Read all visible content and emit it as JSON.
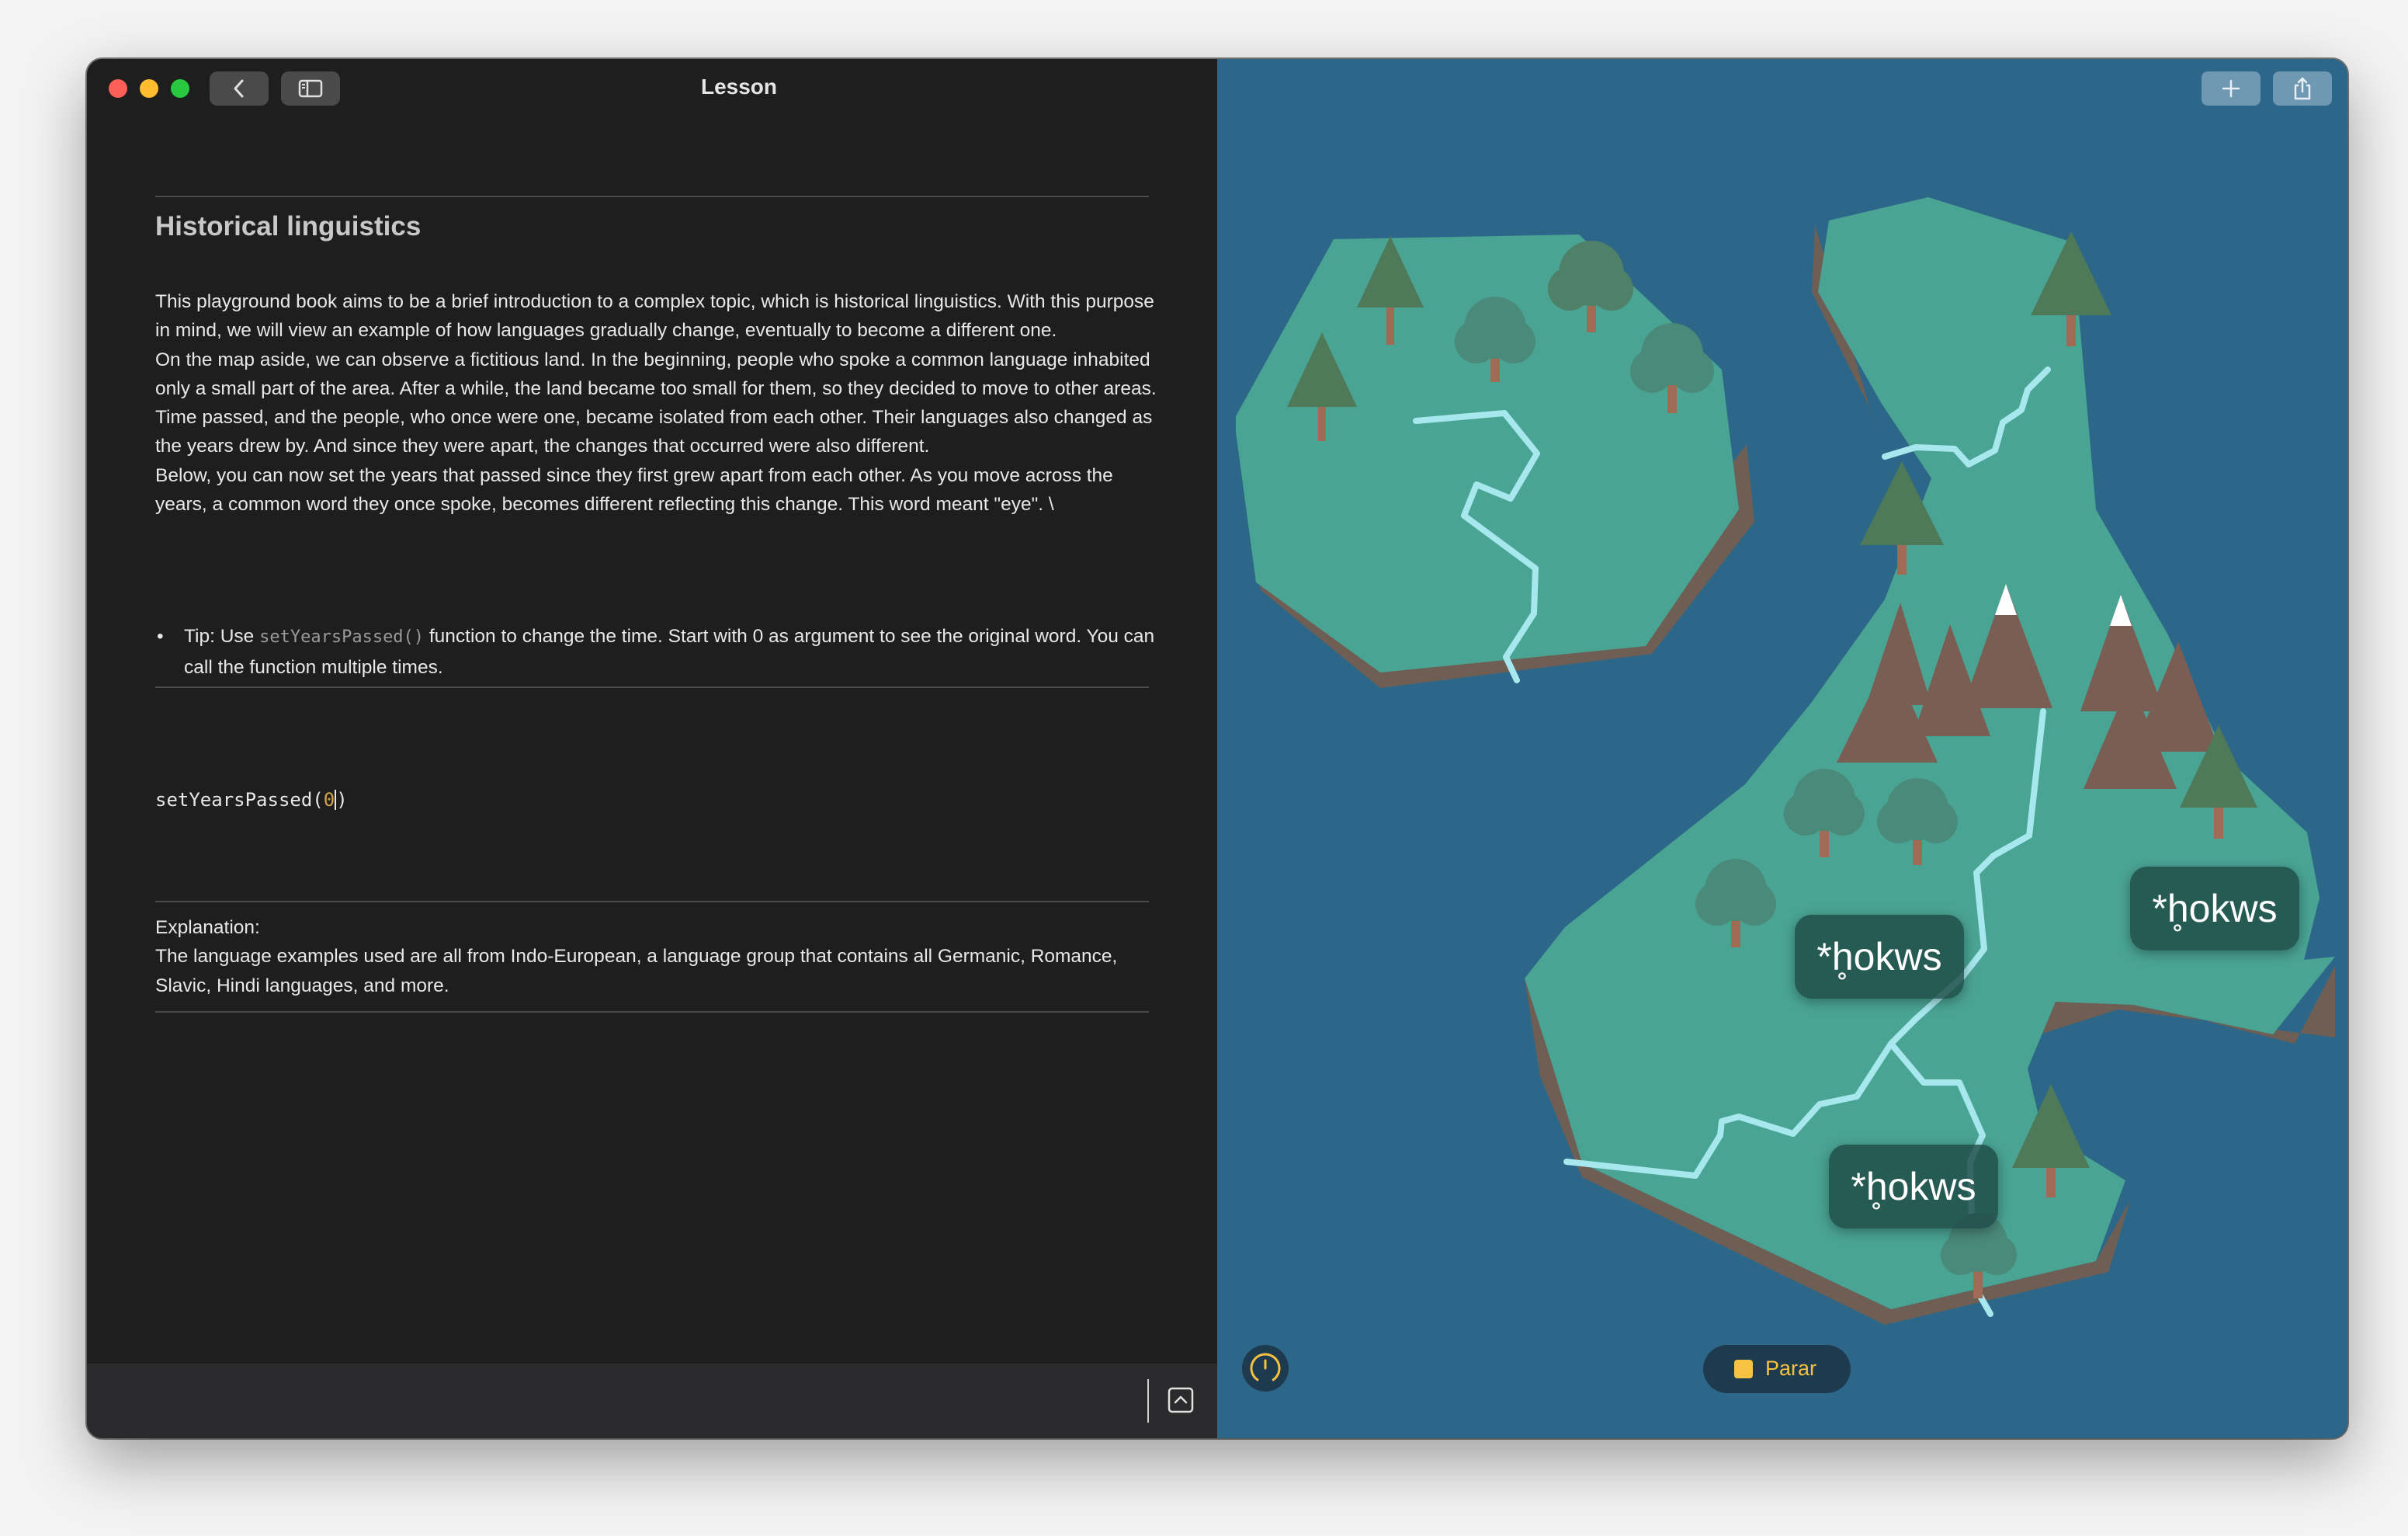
{
  "window": {
    "title": "Lesson"
  },
  "lesson": {
    "heading": "Historical linguistics",
    "paragraphs": [
      "This playground book aims to be a brief introduction to a complex topic, which is historical linguistics. With this purpose in mind, we will view an example of how languages gradually change, eventually to become a different one.",
      "On the map aside, we can observe a fictitious land. In the beginning, people who spoke a common language inhabited only a small part of the area. After a while, the land became too small for them, so they decided to move to other areas. Time passed, and the people, who once were one,  became isolated from each other. Their languages also changed as the years drew by. And since they were apart, the changes that occurred were also different.",
      "Below, you can now set the years that passed since they first grew apart from each other. As you move across the years, a common word they once spoke, becomes different reflecting this change. This word meant \"eye\". \\"
    ],
    "tip": {
      "bullet": "•",
      "prefix": "Tip: Use ",
      "code": "setYearsPassed()",
      "suffix": " function to change the time. Start with 0 as argument to see the original word. You can call the function multiple times."
    },
    "code": {
      "func_open": "setYearsPassed(",
      "arg": "0",
      "close": ")"
    },
    "explanation": {
      "label": "Explanation:",
      "text": "The language examples used are all from Indo-European, a language group that contains all Germanic, Romance, Slavic, Hindi languages, and more."
    }
  },
  "map": {
    "labels": [
      "*h̥okws",
      "*h̥okws",
      "*h̥okws"
    ],
    "colors": {
      "sea": "#2c6789",
      "land": "#4aa494",
      "cliff": "#6e5e54",
      "river": "#a6e8ee",
      "tree_top": "#4f7a5a",
      "bush": "#4a8a7a",
      "mountain": "#7a5e54"
    }
  },
  "controls": {
    "stop_label": "Parar",
    "icons": {
      "back": "chevron-left-icon",
      "sidebar": "sidebar-icon",
      "add": "plus-icon",
      "share": "share-icon",
      "speed": "speedometer-icon",
      "stop": "stop-square-icon",
      "expand": "chevron-up-square-icon"
    }
  }
}
